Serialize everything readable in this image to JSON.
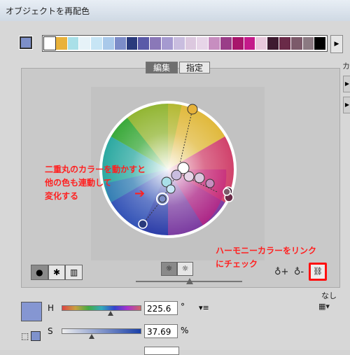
{
  "window": {
    "title": "オブジェクトを再配色"
  },
  "strip": {
    "colors": [
      "#ffffff",
      "#e9b23a",
      "#a9e0e8",
      "#e6f2f8",
      "#c7e5f5",
      "#a9c9ea",
      "#7c8cc8",
      "#2a3a7c",
      "#5a5aa8",
      "#8a78b8",
      "#a59ad0",
      "#c9bddf",
      "#dcc8df",
      "#e7d5e8",
      "#c78ec0",
      "#9a3d88",
      "#a8156b",
      "#c41a8a",
      "#e8c8dc",
      "#3d1a30",
      "#6a2a48",
      "#7c5a6a",
      "#8b7a82",
      "#000000"
    ]
  },
  "tabs": {
    "edit": "編集",
    "assign": "指定"
  },
  "right_panel": {
    "label": "カ"
  },
  "annotations": {
    "left_line1": "二重丸のカラーを動かすと",
    "left_line2": "他の色も連動して",
    "left_line3": "変化する",
    "right_line1": "ハーモニーカラーをリンク",
    "right_line2": "にチェック"
  },
  "controls": {
    "none_label": "なし",
    "h_label": "H",
    "s_label": "S",
    "h_value": "225.6",
    "s_value": "37.69",
    "h_unit": "°",
    "s_unit": "%"
  },
  "icons": {
    "mode_smooth": "●",
    "mode_segment": "✱",
    "mode_bars": "▥",
    "brightness_on": "☼",
    "brightness_off": "☼",
    "add_color": "♁+",
    "remove_color": "♁-",
    "link_harmony": "⛓",
    "menu": "▾≡",
    "grid": "▦▾",
    "scroll": "▶"
  },
  "accent_color": "#ff2020"
}
